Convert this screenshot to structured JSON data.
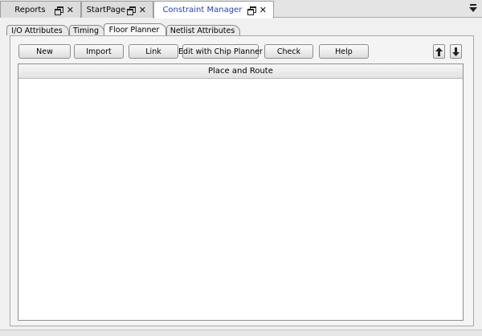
{
  "doc_tabs": [
    {
      "label": "Reports",
      "active": false
    },
    {
      "label": "StartPage",
      "active": false
    },
    {
      "label": "Constraint Manager",
      "active": true
    }
  ],
  "doc_tab_icons": {
    "float": "float-window-icon",
    "close": "close-icon",
    "menu": "tab-list-menu-icon"
  },
  "sub_tabs": [
    {
      "label": "I/O Attributes",
      "active": false
    },
    {
      "label": "Timing",
      "active": false
    },
    {
      "label": "Floor Planner",
      "active": true
    },
    {
      "label": "Netlist Attributes",
      "active": false
    }
  ],
  "toolbar": {
    "new_label": "New",
    "import_label": "Import",
    "link_label": "Link",
    "edit_chip_planner_label": "Edit with Chip Planner",
    "check_label": "Check",
    "help_label": "Help",
    "move_up_icon": "arrow-up-icon",
    "move_down_icon": "arrow-down-icon"
  },
  "table": {
    "columns": [
      "Place and Route"
    ],
    "rows": []
  },
  "colors": {
    "active_tab_text": "#2a3fb8",
    "background": "#f0f0f0"
  }
}
